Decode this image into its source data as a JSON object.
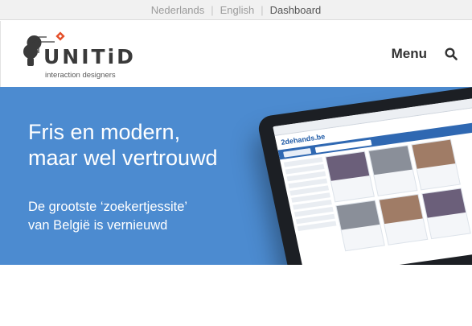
{
  "topbar": {
    "languages": [
      "Nederlands",
      "English"
    ],
    "separators": [
      "|",
      "|"
    ],
    "dashboard": "Dashboard"
  },
  "brand": {
    "name": "UNITiD",
    "tagline": "interaction designers",
    "accent": "#e4502b"
  },
  "nav": {
    "menu_label": "Menu"
  },
  "hero": {
    "title_line1": "Fris en modern,",
    "title_line2": "maar wel vertrouwd",
    "subtitle_line1": "De grootste ‘zoekertjessite’",
    "subtitle_line2": "van België is vernieuwd",
    "background": "#4c8bd0"
  },
  "tablet_screen": {
    "logo": "2dehands.be"
  },
  "icons": {
    "search": "search-icon",
    "logo_mark": "bulb-icon"
  }
}
